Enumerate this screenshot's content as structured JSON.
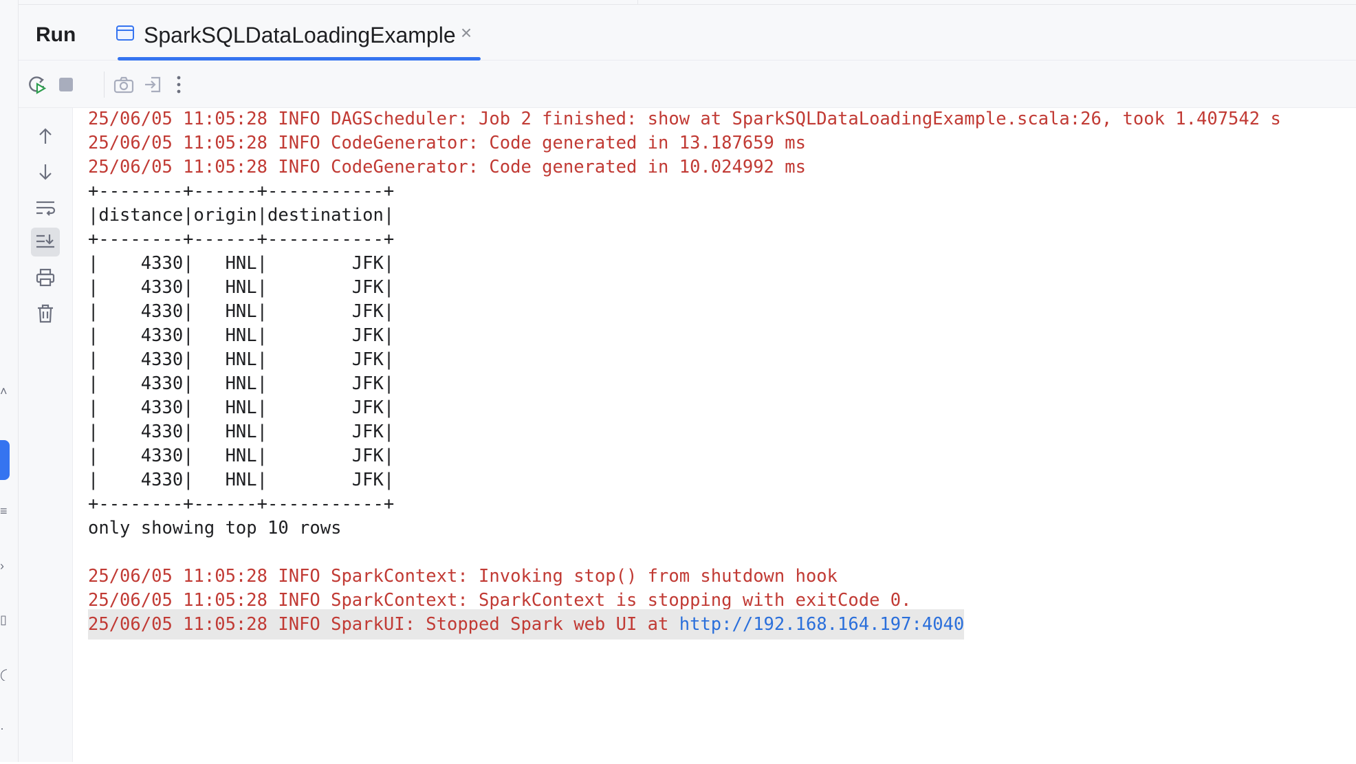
{
  "run_window": {
    "title": "Run",
    "tab": {
      "label": "SparkSQLDataLoadingExample",
      "close_glyph": "×"
    }
  },
  "toolbar": {
    "buttons": [
      {
        "name": "rerun-icon",
        "label": "Rerun"
      },
      {
        "name": "stop-icon",
        "label": "Stop"
      },
      {
        "name": "camera-icon",
        "label": "Dump Threads"
      },
      {
        "name": "exit-icon",
        "label": "Exit"
      },
      {
        "name": "more-options-icon",
        "label": "More Options"
      }
    ]
  },
  "side_actions": [
    {
      "name": "up-arrow-icon"
    },
    {
      "name": "down-arrow-icon"
    },
    {
      "name": "soft-wrap-icon"
    },
    {
      "name": "scroll-to-end-icon",
      "active": true
    },
    {
      "name": "print-icon"
    },
    {
      "name": "trash-icon"
    }
  ],
  "console": {
    "lines": [
      {
        "type": "log",
        "text": "25/06/05 11:05:28 INFO DAGScheduler: Job 2 finished: show at SparkSQLDataLoadingExample.scala:26, took 1.407542 s"
      },
      {
        "type": "log",
        "text": "25/06/05 11:05:28 INFO CodeGenerator: Code generated in 13.187659 ms"
      },
      {
        "type": "log",
        "text": "25/06/05 11:05:28 INFO CodeGenerator: Code generated in 10.024992 ms"
      },
      {
        "type": "out",
        "text": "+--------+------+-----------+"
      },
      {
        "type": "out",
        "text": "|distance|origin|destination|"
      },
      {
        "type": "out",
        "text": "+--------+------+-----------+"
      },
      {
        "type": "out",
        "text": "|    4330|   HNL|        JFK|"
      },
      {
        "type": "out",
        "text": "|    4330|   HNL|        JFK|"
      },
      {
        "type": "out",
        "text": "|    4330|   HNL|        JFK|"
      },
      {
        "type": "out",
        "text": "|    4330|   HNL|        JFK|"
      },
      {
        "type": "out",
        "text": "|    4330|   HNL|        JFK|"
      },
      {
        "type": "out",
        "text": "|    4330|   HNL|        JFK|"
      },
      {
        "type": "out",
        "text": "|    4330|   HNL|        JFK|"
      },
      {
        "type": "out",
        "text": "|    4330|   HNL|        JFK|"
      },
      {
        "type": "out",
        "text": "|    4330|   HNL|        JFK|"
      },
      {
        "type": "out",
        "text": "|    4330|   HNL|        JFK|"
      },
      {
        "type": "out",
        "text": "+--------+------+-----------+"
      },
      {
        "type": "out",
        "text": "only showing top 10 rows"
      },
      {
        "type": "out",
        "text": ""
      },
      {
        "type": "log",
        "text": "25/06/05 11:05:28 INFO SparkContext: Invoking stop() from shutdown hook"
      },
      {
        "type": "log",
        "text": "25/06/05 11:05:28 INFO SparkContext: SparkContext is stopping with exitCode 0."
      }
    ],
    "last_line": {
      "prefix": "25/06/05 11:05:28 INFO SparkUI: Stopped Spark web UI at ",
      "link": "http://192.168.164.197:4040"
    }
  },
  "colors": {
    "log_text": "#c13a34",
    "stdout_text": "#1e1f22",
    "accent": "#3574f0",
    "link": "#2a6fdb"
  }
}
